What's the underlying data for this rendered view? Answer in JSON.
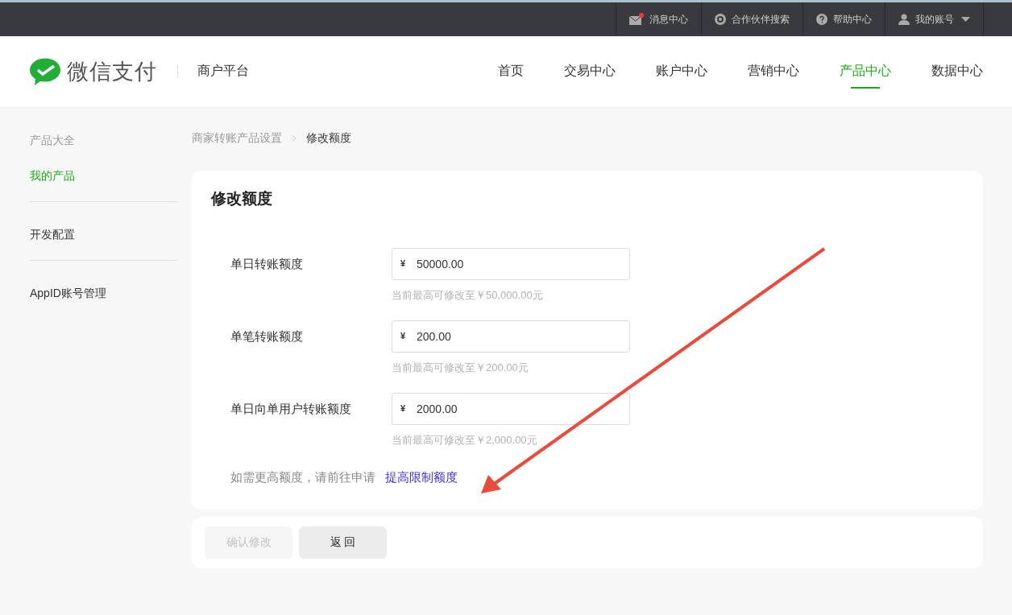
{
  "top_bar": {
    "items": [
      {
        "kind": "mail",
        "label": "消息中心",
        "badge": true
      },
      {
        "kind": "search",
        "label": "合作伙伴搜索",
        "badge": false
      },
      {
        "kind": "help",
        "label": "帮助中心",
        "badge": false
      },
      {
        "kind": "user",
        "label": "我的账号",
        "badge": false,
        "dropdown": true
      }
    ]
  },
  "header": {
    "logo_text": "微信支付",
    "platform": "商户平台",
    "nav": [
      {
        "label": "首页",
        "selected": false
      },
      {
        "label": "交易中心",
        "selected": false
      },
      {
        "label": "账户中心",
        "selected": false
      },
      {
        "label": "营销中心",
        "selected": false
      },
      {
        "label": "产品中心",
        "selected": true
      },
      {
        "label": "数据中心",
        "selected": false
      }
    ]
  },
  "sidebar": {
    "groups": [
      [
        {
          "label": "产品大全",
          "selected": false
        },
        {
          "label": "我的产品",
          "selected": true
        }
      ],
      [
        {
          "label": "开发配置",
          "selected": false
        }
      ],
      [
        {
          "label": "AppID账号管理",
          "selected": false
        }
      ]
    ]
  },
  "breadcrumb": [
    "商家转账产品设置",
    "修改额度"
  ],
  "form": {
    "title": "修改额度",
    "fields": [
      {
        "label": "单日转账额度",
        "currency": "¥",
        "value": "50000.00",
        "hint": "当前最高可修改至￥50,000.00元"
      },
      {
        "label": "单笔转账额度",
        "currency": "¥",
        "value": "200.00",
        "hint": "当前最高可修改至￥200.00元"
      },
      {
        "label": "单日向单用户转账额度",
        "currency": "¥",
        "value": "2000.00",
        "hint": "当前最高可修改至￥2,000.00元"
      }
    ],
    "note": "如需更高额度，请前往申请",
    "link": "提高限制额度"
  },
  "buttons": [
    {
      "label": "确认修改",
      "disabled": true
    },
    {
      "label": "返 回",
      "disabled": false
    }
  ]
}
